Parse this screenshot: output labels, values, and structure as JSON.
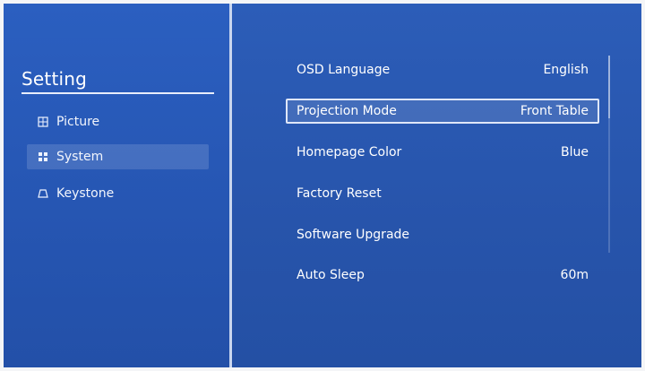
{
  "sidebar": {
    "title": "Setting",
    "items": [
      {
        "label": "Picture",
        "icon": "picture-icon"
      },
      {
        "label": "System",
        "icon": "system-icon",
        "active": true
      },
      {
        "label": "Keystone",
        "icon": "keystone-icon"
      }
    ]
  },
  "settings": {
    "rows": [
      {
        "label": "OSD Language",
        "value": "English"
      },
      {
        "label": "Projection Mode",
        "value": "Front Table",
        "selected": true
      },
      {
        "label": "Homepage Color",
        "value": "Blue"
      },
      {
        "label": "Factory Reset",
        "value": ""
      },
      {
        "label": "Software Upgrade",
        "value": ""
      },
      {
        "label": "Auto Sleep",
        "value": "60m"
      }
    ]
  },
  "colors": {
    "panel_blue": "#2753a8",
    "sidebar_blue": "#2b5fc0",
    "text": "#ffffff",
    "highlight_border": "#dfe7f8"
  }
}
